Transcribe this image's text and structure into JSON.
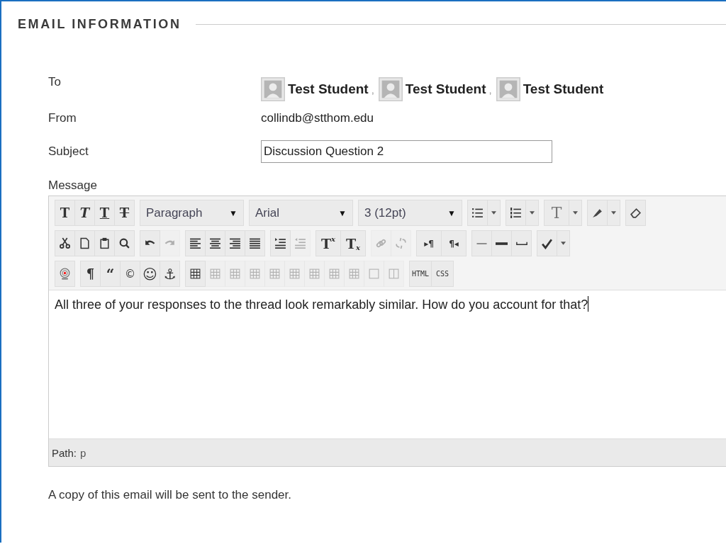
{
  "section": {
    "title": "EMAIL INFORMATION"
  },
  "to": {
    "label": "To",
    "separator": ",",
    "recipients": [
      "Test Student",
      "Test Student",
      "Test Student"
    ]
  },
  "from": {
    "label": "From",
    "value": "collindb@stthom.edu"
  },
  "subject": {
    "label": "Subject",
    "value": "Discussion Question 2"
  },
  "message": {
    "label": "Message",
    "toolbar": [
      [
        [
          {
            "kind": "glyph",
            "glyph": "T",
            "disabled": false
          },
          {
            "kind": "glyph",
            "glyph": "T",
            "disabled": false
          },
          {
            "kind": "glyph",
            "glyph": "T",
            "disabled": false
          },
          {
            "kind": "glyph",
            "glyph": "T",
            "disabled": false
          }
        ],
        [
          {
            "kind": "select",
            "value": "Paragraph",
            "caret": "▼"
          }
        ],
        [
          {
            "kind": "select",
            "value": "Arial",
            "caret": "▼"
          }
        ],
        [
          {
            "kind": "select",
            "value": "3 (12pt)",
            "caret": "▼"
          }
        ],
        [
          {
            "kind": "split",
            "disabled": false
          }
        ],
        [
          {
            "kind": "split",
            "disabled": false
          }
        ],
        [
          {
            "kind": "split",
            "glyph": "T",
            "disabled": false
          }
        ],
        [
          {
            "kind": "split",
            "disabled": false
          }
        ],
        [
          {
            "kind": "icon",
            "disabled": false
          }
        ]
      ],
      [
        [
          {
            "kind": "icon",
            "disabled": false
          },
          {
            "kind": "icon",
            "disabled": false
          },
          {
            "kind": "icon",
            "disabled": false
          },
          {
            "kind": "icon",
            "disabled": false
          }
        ],
        [
          {
            "kind": "icon",
            "disabled": false
          },
          {
            "kind": "icon",
            "disabled": true
          }
        ],
        [
          {
            "kind": "icon",
            "disabled": false
          },
          {
            "kind": "icon",
            "disabled": false
          },
          {
            "kind": "icon",
            "disabled": false
          },
          {
            "kind": "icon",
            "disabled": false
          }
        ],
        [
          {
            "kind": "icon",
            "disabled": false
          },
          {
            "kind": "icon",
            "disabled": true
          }
        ],
        [
          {
            "kind": "glyph",
            "glyph": "T",
            "sub": "x",
            "disabled": false
          },
          {
            "kind": "glyph",
            "glyph": "T",
            "sub": "x",
            "disabled": false
          }
        ],
        [
          {
            "kind": "icon",
            "disabled": true
          },
          {
            "kind": "icon",
            "disabled": true
          }
        ],
        [
          {
            "kind": "glyph",
            "glyph": "▸¶",
            "disabled": false
          },
          {
            "kind": "glyph",
            "glyph": "¶◂",
            "disabled": false
          }
        ],
        [
          {
            "kind": "icon",
            "disabled": false
          },
          {
            "kind": "icon",
            "disabled": false
          },
          {
            "kind": "icon",
            "disabled": false
          }
        ],
        [
          {
            "kind": "split",
            "disabled": false
          }
        ]
      ],
      [
        [
          {
            "kind": "icon",
            "disabled": false
          }
        ],
        [
          {
            "kind": "glyph",
            "glyph": "¶",
            "disabled": false
          },
          {
            "kind": "glyph",
            "glyph": "“",
            "disabled": false
          },
          {
            "kind": "glyph",
            "glyph": "©",
            "disabled": false
          },
          {
            "kind": "glyph",
            "glyph": "☺",
            "disabled": false
          },
          {
            "kind": "glyph",
            "glyph": "⚓",
            "disabled": false
          }
        ],
        [
          {
            "kind": "icon",
            "disabled": false
          },
          {
            "kind": "icon",
            "disabled": true
          },
          {
            "kind": "icon",
            "disabled": true
          },
          {
            "kind": "icon",
            "disabled": true
          },
          {
            "kind": "icon",
            "disabled": true
          },
          {
            "kind": "icon",
            "disabled": true
          },
          {
            "kind": "icon",
            "disabled": true
          },
          {
            "kind": "icon",
            "disabled": true
          },
          {
            "kind": "icon",
            "disabled": true
          },
          {
            "kind": "icon",
            "disabled": true
          },
          {
            "kind": "icon",
            "disabled": true
          }
        ],
        [
          {
            "kind": "glyph",
            "glyph": "HTML",
            "disabled": false
          },
          {
            "kind": "glyph",
            "glyph": "CSS",
            "disabled": false
          }
        ]
      ]
    ],
    "body": "All three of your responses to the thread look remarkably similar. How do you account for that?",
    "path_label": "Path:",
    "path": "p"
  },
  "note": "A copy of this email will be sent to the sender."
}
